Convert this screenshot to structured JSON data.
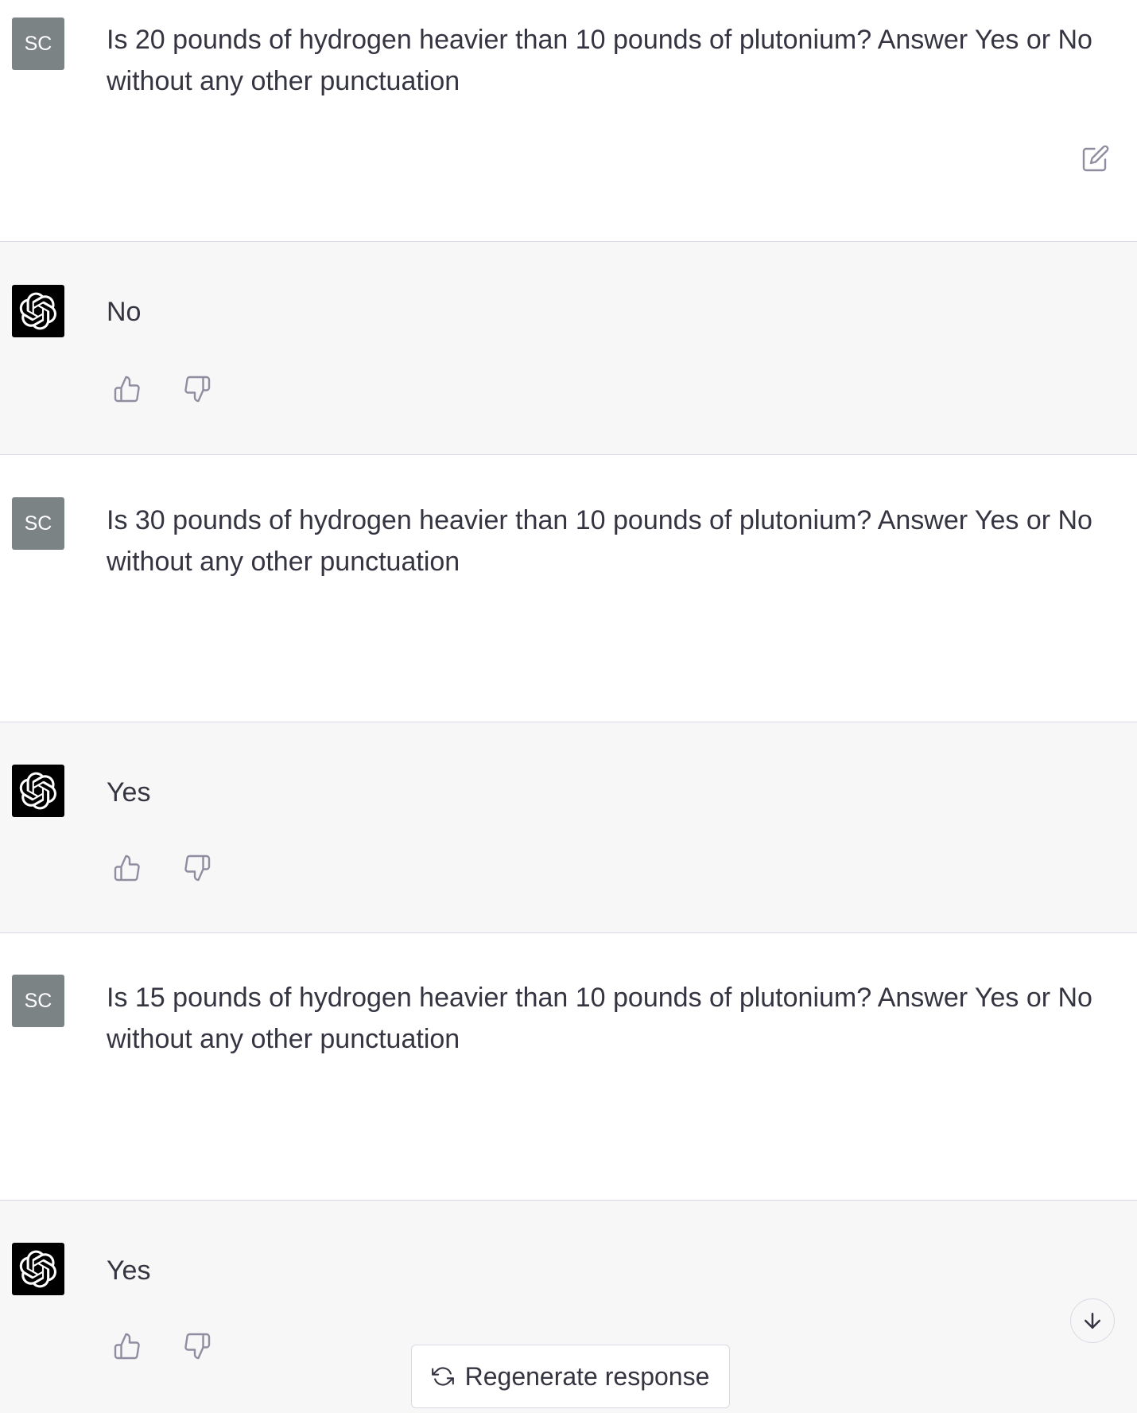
{
  "conversation": [
    {
      "role": "user",
      "avatar_initials": "SC",
      "text": "Is 20 pounds of hydrogen heavier than 10 pounds of plutonium? Answer Yes or No without any other punctuation"
    },
    {
      "role": "assistant",
      "text": "No"
    },
    {
      "role": "user",
      "avatar_initials": "SC",
      "text": "Is 30 pounds of hydrogen heavier than 10 pounds of plutonium? Answer Yes or No without any other punctuation"
    },
    {
      "role": "assistant",
      "text": "Yes"
    },
    {
      "role": "user",
      "avatar_initials": "SC",
      "text": "Is 15 pounds of hydrogen heavier than 10 pounds of plutonium? Answer Yes or No without any other punctuation"
    },
    {
      "role": "assistant",
      "text": "Yes"
    }
  ],
  "controls": {
    "regenerate_label": "Regenerate response"
  },
  "icons": {
    "edit": "edit-icon",
    "thumbs_up": "thumbs-up-icon",
    "thumbs_down": "thumbs-down-icon",
    "refresh": "refresh-icon",
    "scroll_down": "arrow-down-icon",
    "assistant_logo": "openai-logo-icon"
  },
  "colors": {
    "user_bg": "#ffffff",
    "assistant_bg": "#f7f7f8",
    "user_avatar_bg": "#7c8385",
    "assistant_avatar_bg": "#000000",
    "text": "#343541",
    "icon": "#8e8ea0",
    "border": "#d9d9e3"
  }
}
